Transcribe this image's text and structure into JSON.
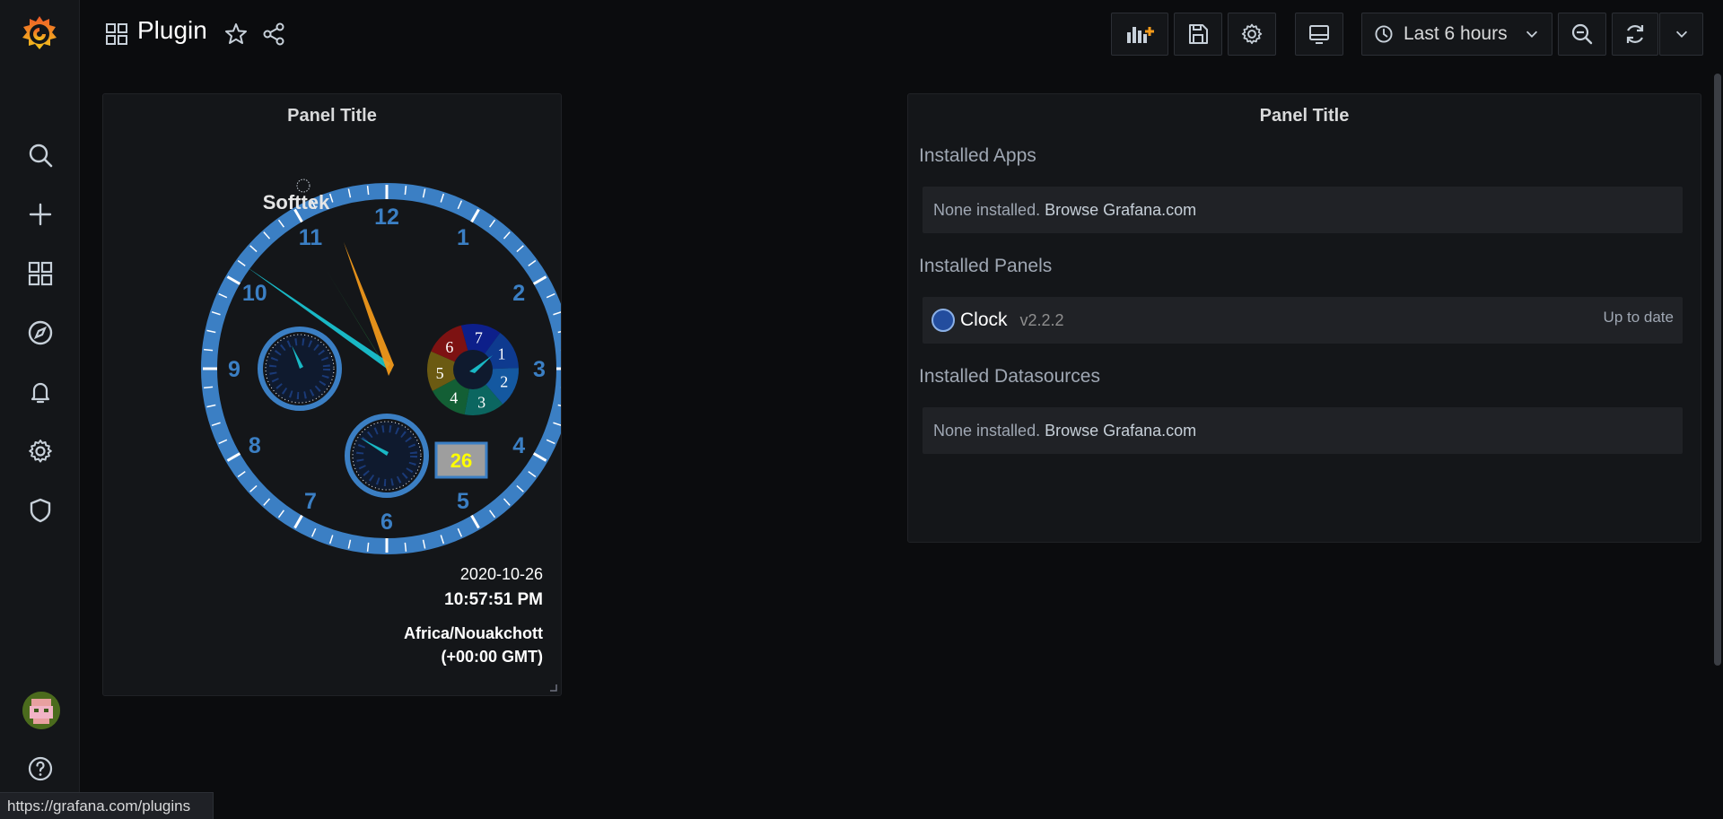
{
  "header": {
    "title": "Plugin",
    "time_range": "Last 6 hours"
  },
  "clock_panel": {
    "title": "Panel Title",
    "brand": "Softtek",
    "date": "2020-10-26",
    "time": "10:57:51 PM",
    "timezone": "Africa/Nouakchott",
    "offset": "(+00:00 GMT)",
    "day_of_month": "26",
    "dial_numbers": [
      "12",
      "1",
      "2",
      "3",
      "4",
      "5",
      "6",
      "7",
      "8",
      "9",
      "10",
      "11"
    ],
    "subdial_numbers": [
      "1",
      "2",
      "3",
      "4",
      "5",
      "6",
      "7"
    ]
  },
  "plugins_panel": {
    "title": "Panel Title",
    "apps_heading": "Installed Apps",
    "apps_none": "None installed.",
    "apps_browse": "Browse Grafana.com",
    "panels_heading": "Installed Panels",
    "panel_item": {
      "name": "Clock",
      "version": "v2.2.2",
      "status": "Up to date"
    },
    "datasources_heading": "Installed Datasources",
    "ds_none": "None installed.",
    "ds_browse": "Browse Grafana.com"
  },
  "status_bar": {
    "url": "https://grafana.com/plugins"
  },
  "colors": {
    "background": "#0b0c0e",
    "panel": "#141619",
    "clock_blue": "#3b7fc4",
    "accent_orange": "#f59b1a"
  },
  "icons": {
    "sidebar": [
      "grafana-logo-icon",
      "search-icon",
      "plus-icon",
      "dashboards-icon",
      "explore-icon",
      "alert-bell-icon",
      "gear-icon",
      "shield-icon",
      "help-icon"
    ],
    "toolbar": [
      "add-panel-icon",
      "save-icon",
      "settings-icon",
      "tv-mode-icon",
      "clock-icon",
      "zoom-out-icon",
      "refresh-icon",
      "chevron-down-icon"
    ]
  }
}
